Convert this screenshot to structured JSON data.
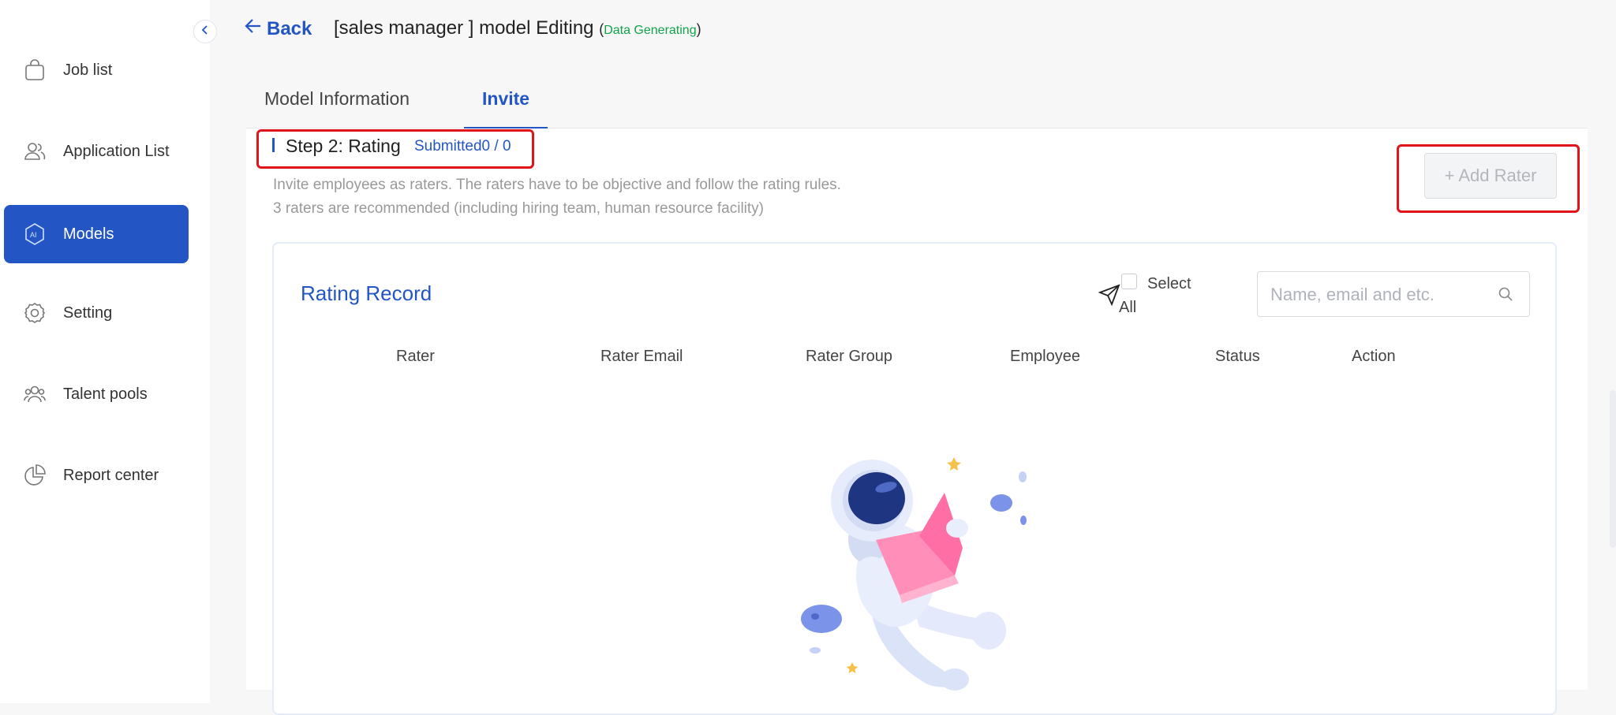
{
  "sidebar": {
    "items": [
      {
        "label": "Job list",
        "icon": "shopping-bag-icon"
      },
      {
        "label": "Application List",
        "icon": "users-icon"
      },
      {
        "label": "Models",
        "icon": "ai-hexagon-icon",
        "active": true
      },
      {
        "label": "Setting",
        "icon": "gear-icon"
      },
      {
        "label": "Talent pools",
        "icon": "group-icon"
      },
      {
        "label": "Report center",
        "icon": "pie-chart-icon"
      }
    ]
  },
  "header": {
    "back_label": "Back",
    "title": "[sales manager ] model Editing",
    "status_open": "(",
    "status": "Data Generating",
    "status_close": ")"
  },
  "tabs": [
    {
      "label": "Model Information"
    },
    {
      "label": "Invite",
      "active": true
    }
  ],
  "step": {
    "title": "Step 2: Rating",
    "submitted": "Submitted0 / 0",
    "description_1": "Invite employees as raters. The raters have to be objective and follow the rating rules.",
    "description_2": "3 raters are recommended (including hiring team, human resource facility)"
  },
  "actions": {
    "add_rater_label": "+ Add Rater"
  },
  "record": {
    "title": "Rating Record",
    "select_all_label": "Select All",
    "search_placeholder": "Name, email and etc.",
    "columns": [
      "Rater",
      "Rater Email",
      "Rater Group",
      "Employee",
      "Status",
      "Action"
    ]
  },
  "colors": {
    "accent": "#2356c4",
    "status_green": "#12a34a",
    "highlight_red": "#e0141b"
  }
}
